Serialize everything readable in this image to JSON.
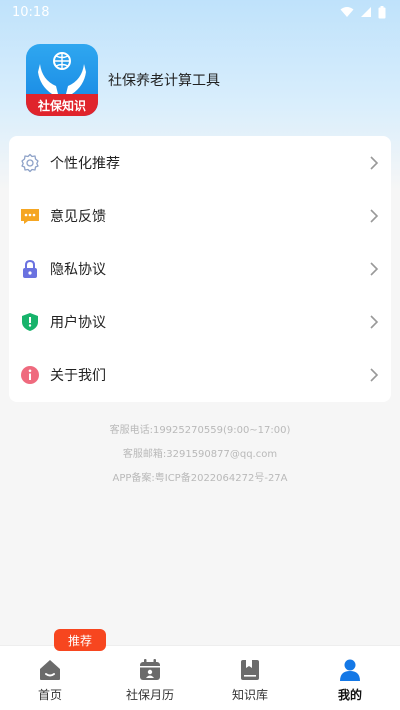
{
  "status_bar": {
    "time": "10:18"
  },
  "header": {
    "logo_text": "社保知识",
    "app_name": "社保养老计算工具"
  },
  "menu": {
    "items": [
      {
        "label": "个性化推荐",
        "icon": "gear-icon"
      },
      {
        "label": "意见反馈",
        "icon": "chat-icon"
      },
      {
        "label": "隐私协议",
        "icon": "lock-icon"
      },
      {
        "label": "用户协议",
        "icon": "shield-icon"
      },
      {
        "label": "关于我们",
        "icon": "info-icon"
      }
    ]
  },
  "footer_info": {
    "phone": "客服电话:19925270559(9:00~17:00)",
    "email": "客服邮箱:3291590877@qq.com",
    "icp": "APP备案:粤ICP备2022064272号-27A"
  },
  "bottom_nav": {
    "badge": "推荐",
    "items": [
      {
        "label": "首页",
        "icon": "home-icon"
      },
      {
        "label": "社保月历",
        "icon": "calendar-icon"
      },
      {
        "label": "知识库",
        "icon": "book-icon"
      },
      {
        "label": "我的",
        "icon": "user-icon",
        "active": true
      }
    ]
  },
  "colors": {
    "accent": "#1478e6",
    "badge": "#f7461f",
    "logo_ribbon": "#e0242c"
  }
}
